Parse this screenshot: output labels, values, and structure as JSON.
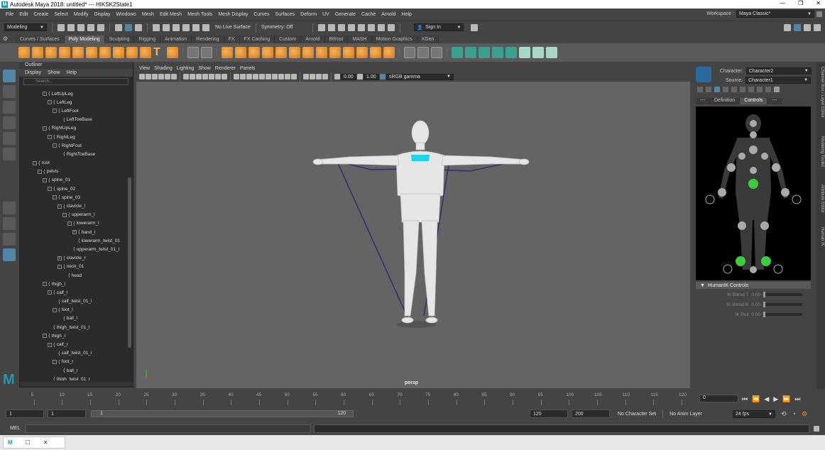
{
  "titlebar": {
    "title": "Autodesk Maya 2018: untitled*  ---  HIKSK2State1",
    "app_icon_letter": "M",
    "minimize": "—",
    "restore": "❐",
    "close": "✕"
  },
  "menubar": {
    "items": [
      "File",
      "Edit",
      "Create",
      "Select",
      "Modify",
      "Display",
      "Windows",
      "Mesh",
      "Edit Mesh",
      "Mesh Tools",
      "Mesh Display",
      "Curves",
      "Surfaces",
      "Deform",
      "UV",
      "Generate",
      "Cache",
      "Arnold",
      "Help"
    ],
    "workspace_label": "Workspace :",
    "workspace_value": "Maya Classic*"
  },
  "statusline": {
    "mode": "Modeling",
    "live_surface": "No Live Surface",
    "symmetry": "Symmetry: Off",
    "sign_in": "Sign In"
  },
  "shelf": {
    "tabs": [
      "Curves / Surfaces",
      "Poly Modeling",
      "Sculpting",
      "Rigging",
      "Animation",
      "Rendering",
      "FX",
      "FX Caching",
      "Custom",
      "Arnold",
      "Bifrost",
      "MASH",
      "Motion Graphics",
      "XGen"
    ],
    "active_tab": "Poly Modeling"
  },
  "outliner": {
    "title": "Outliner",
    "menu": [
      "Display",
      "Show",
      "Help"
    ],
    "search_placeholder": "Search...",
    "rows": [
      {
        "label": "LeftUpLeg",
        "indent": 3,
        "exp": "-"
      },
      {
        "label": "LeftLeg",
        "indent": 4,
        "exp": "-"
      },
      {
        "label": "LeftFoot",
        "indent": 5,
        "exp": "-"
      },
      {
        "label": "LeftToeBase",
        "indent": 6,
        "exp": ""
      },
      {
        "label": "RightUpLeg",
        "indent": 3,
        "exp": "-"
      },
      {
        "label": "RightLeg",
        "indent": 4,
        "exp": "-"
      },
      {
        "label": "RightFoot",
        "indent": 5,
        "exp": "-"
      },
      {
        "label": "RightToeBase",
        "indent": 6,
        "exp": ""
      },
      {
        "label": "root",
        "indent": 1,
        "exp": "-"
      },
      {
        "label": "pelvis",
        "indent": 2,
        "exp": "-"
      },
      {
        "label": "spine_01",
        "indent": 3,
        "exp": "-"
      },
      {
        "label": "spine_02",
        "indent": 4,
        "exp": "-"
      },
      {
        "label": "spine_03",
        "indent": 5,
        "exp": "-"
      },
      {
        "label": "clavicle_l",
        "indent": 6,
        "exp": "-"
      },
      {
        "label": "upperarm_l",
        "indent": 7,
        "exp": "-"
      },
      {
        "label": "lowerarm_l",
        "indent": 8,
        "exp": "-"
      },
      {
        "label": "hand_l",
        "indent": 9,
        "exp": "+"
      },
      {
        "label": "lowerarm_twist_01",
        "indent": 9,
        "exp": ""
      },
      {
        "label": "upperarm_twist_01_l",
        "indent": 8,
        "exp": ""
      },
      {
        "label": "clavicle_r",
        "indent": 6,
        "exp": "+"
      },
      {
        "label": "neck_01",
        "indent": 6,
        "exp": "-"
      },
      {
        "label": "head",
        "indent": 7,
        "exp": ""
      },
      {
        "label": "thigh_l",
        "indent": 3,
        "exp": "-"
      },
      {
        "label": "calf_l",
        "indent": 4,
        "exp": "-"
      },
      {
        "label": "calf_twist_01_l",
        "indent": 5,
        "exp": ""
      },
      {
        "label": "foot_l",
        "indent": 5,
        "exp": "-"
      },
      {
        "label": "ball_l",
        "indent": 6,
        "exp": ""
      },
      {
        "label": "thigh_twist_01_l",
        "indent": 4,
        "exp": ""
      },
      {
        "label": "thigh_r",
        "indent": 3,
        "exp": "-"
      },
      {
        "label": "calf_r",
        "indent": 4,
        "exp": "-"
      },
      {
        "label": "calf_twist_01_r",
        "indent": 5,
        "exp": ""
      },
      {
        "label": "foot_r",
        "indent": 5,
        "exp": "-"
      },
      {
        "label": "ball_r",
        "indent": 6,
        "exp": ""
      },
      {
        "label": "thigh_twist_01_r",
        "indent": 4,
        "exp": ""
      }
    ]
  },
  "viewport": {
    "menu": [
      "View",
      "Shading",
      "Lighting",
      "Show",
      "Renderer",
      "Panels"
    ],
    "exposure": "0.00",
    "gamma": "1.00",
    "color_space": "sRGB gamma",
    "camera_label": "persp"
  },
  "character_controls": {
    "character_label": "Character:",
    "character_value": "Character2",
    "source_label": "Source:",
    "source_value": "Character1",
    "tabs": [
      "---",
      "Definition",
      "Controls",
      "---"
    ],
    "active_tab": "Controls",
    "hik_header": "HumanIK Controls",
    "sliders": [
      {
        "label": "IK Blend T",
        "value": "0.00"
      },
      {
        "label": "IK Blend R",
        "value": "0.00"
      },
      {
        "label": "IK Pull",
        "value": "0.00"
      }
    ],
    "side_tabs": [
      "Channel Box / Layer Editor",
      "Modeling Toolkit",
      "Attribute Editor",
      "Human IK"
    ]
  },
  "timeslider": {
    "ticks": [
      "5",
      "10",
      "15",
      "20",
      "25",
      "30",
      "35",
      "40",
      "45",
      "50",
      "55",
      "60",
      "65",
      "70",
      "75",
      "80",
      "85",
      "90",
      "95",
      "100",
      "105",
      "110",
      "115",
      "120"
    ],
    "current_frame": "0"
  },
  "range": {
    "start": "1",
    "start_playback": "1",
    "range_start_value": "1",
    "range_end_value": "120",
    "end_playback": "120",
    "end": "200",
    "character_set": "No Character Set",
    "anim_layer": "No Anim Layer",
    "fps": "24 fps"
  },
  "cmdline": {
    "label": "MEL"
  },
  "colors": {
    "accent_blue": "#5285a6",
    "shelf_orange": "#e8962e",
    "hik_green": "#3ccd3c",
    "chest_cyan": "#1cd6e6"
  }
}
